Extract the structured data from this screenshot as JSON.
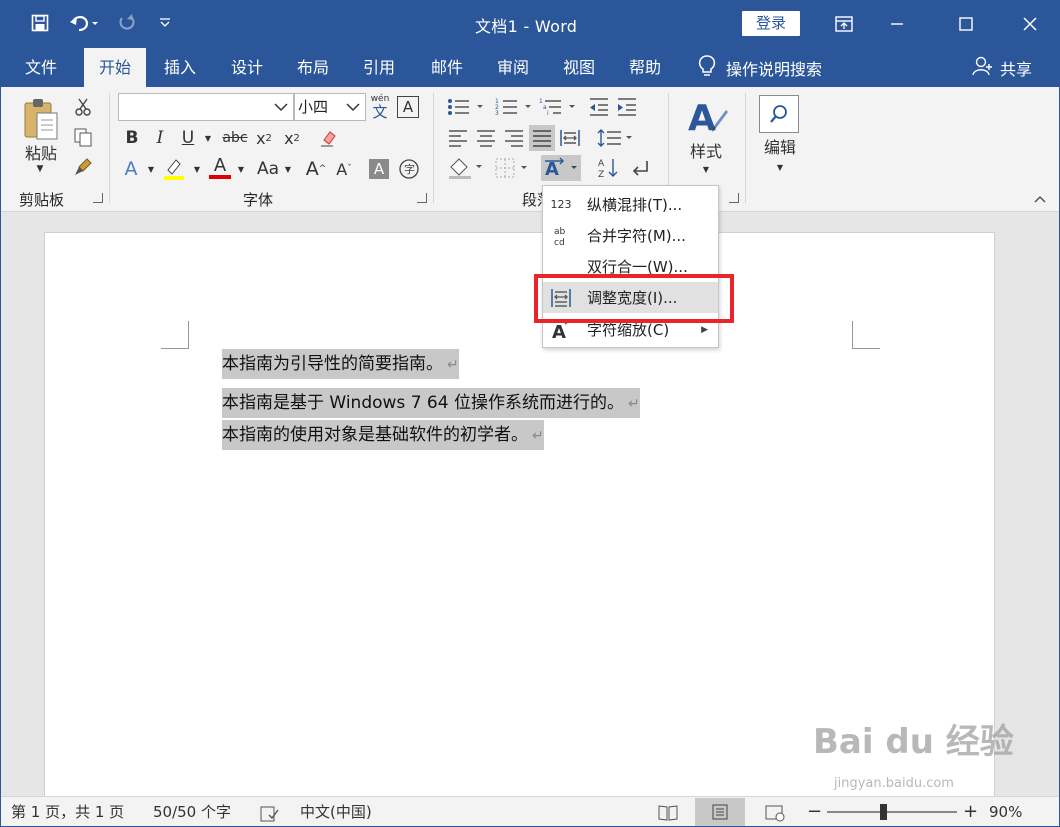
{
  "titlebar": {
    "doc_title": "文档1  -  Word",
    "login": "登录"
  },
  "tabs": [
    {
      "label": "文件"
    },
    {
      "label": "开始"
    },
    {
      "label": "插入"
    },
    {
      "label": "设计"
    },
    {
      "label": "布局"
    },
    {
      "label": "引用"
    },
    {
      "label": "邮件"
    },
    {
      "label": "审阅"
    },
    {
      "label": "视图"
    },
    {
      "label": "帮助"
    }
  ],
  "active_tab": "开始",
  "tell_me": "操作说明搜索",
  "share": "共享",
  "ribbon": {
    "clipboard": {
      "label": "剪贴板",
      "paste": "粘贴"
    },
    "font": {
      "label": "字体",
      "font_name": "",
      "font_size": "小四",
      "phonetic_top": "wén",
      "phonetic_bottom": "文"
    },
    "paragraph": {
      "label": "段落"
    },
    "styles": {
      "label": "样式"
    },
    "editing": {
      "label": "编辑"
    }
  },
  "menu": {
    "items": [
      {
        "icon": "123",
        "label": "纵横混排(T)..."
      },
      {
        "icon": "ab/cd",
        "label": "合并字符(M)..."
      },
      {
        "icon": "",
        "label": "双行合一(W)..."
      },
      {
        "icon": "adjust-width-icon",
        "label": "调整宽度(I)..."
      },
      {
        "icon": "character-scale-icon",
        "label": "字符缩放(C)"
      }
    ]
  },
  "document": {
    "lines": [
      "本指南为引导性的简要指南。",
      "本指南是基于  Windows 7 64 位操作系统而进行的。",
      "本指南的使用对象是基础软件的初学者。"
    ],
    "paragraph_mark": "↵"
  },
  "statusbar": {
    "page": "第 1 页，共 1 页",
    "words": "50/50 个字",
    "language": "中文(中国)",
    "zoom": "90%",
    "zoom_minus": "−",
    "zoom_plus": "+"
  },
  "watermark": {
    "main": "Bai du 经验",
    "sub": "jingyan.baidu.com"
  },
  "colors": {
    "brand": "#2b579a",
    "highlight_box": "#e8252a",
    "selection": "#c8c8c8"
  }
}
